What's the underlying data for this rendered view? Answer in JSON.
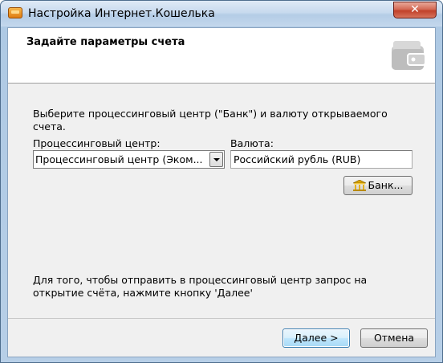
{
  "window": {
    "title": "Настройка Интернет.Кошелька",
    "close_label": "✕"
  },
  "header": {
    "title": "Задайте параметры счета",
    "icon": "wallet-icon"
  },
  "main": {
    "description": "Выберите процессинговый центр (\"Банк\") и валюту открываемого счета.",
    "processing_center": {
      "label": "Процессинговый центр:",
      "value": "Процессинговый центр (Эком..."
    },
    "currency": {
      "label": "Валюта:",
      "value": "Российский рубль (RUB)"
    },
    "bank_button": {
      "label": "Банк...",
      "icon": "bank-icon"
    },
    "info_text": "Для того, чтобы отправить в процессинговый центр запрос на открытие счёта, нажмите кнопку 'Далее'"
  },
  "footer": {
    "next_label": "Далее >",
    "cancel_label": "Отмена"
  },
  "colors": {
    "title_bar": "#c8daee",
    "close_button": "#c0412a",
    "dialog_background": "#f0f0f0",
    "default_button_border": "#3c7fb1"
  }
}
